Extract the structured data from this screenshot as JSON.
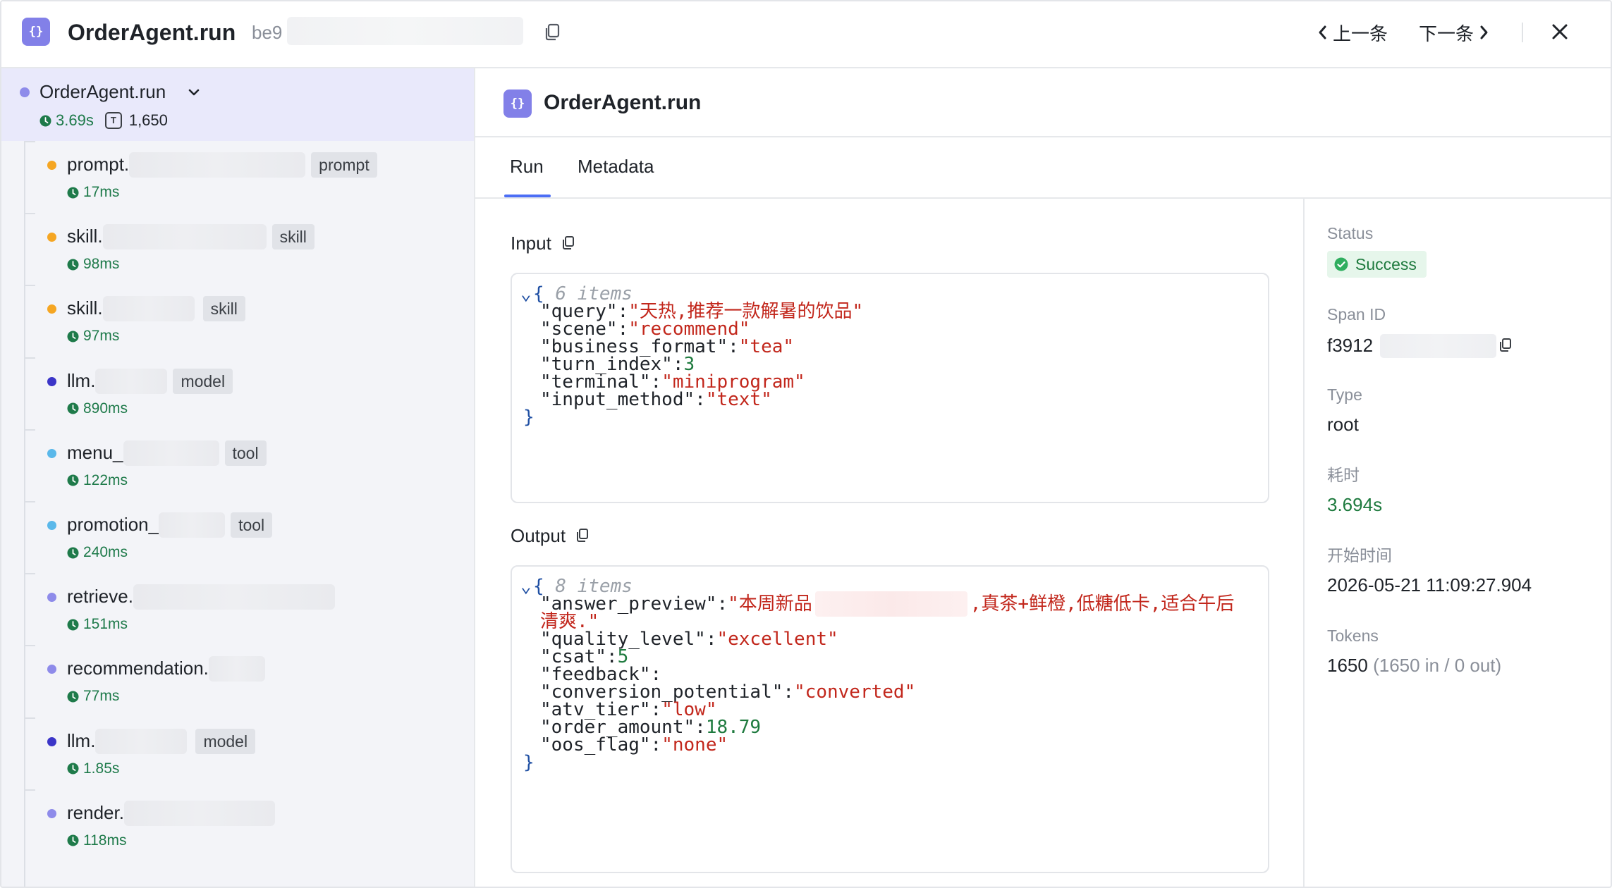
{
  "header": {
    "logo_glyph": "{}",
    "title": "OrderAgent.run",
    "trace_id_prefix": "be9",
    "prev_label": "上一条",
    "next_label": "下一条"
  },
  "tree": {
    "root": {
      "name": "OrderAgent.run",
      "duration": "3.69s",
      "tokens": "1,650",
      "token_glyph": "T"
    },
    "nodes": [
      {
        "name": "prompt.",
        "tag": "prompt",
        "duration": "17ms",
        "color": "#f5a623"
      },
      {
        "name": "skill.",
        "tag": "skill",
        "duration": "98ms",
        "color": "#f5a623"
      },
      {
        "name": "skill.",
        "tag": "skill",
        "duration": "97ms",
        "color": "#f5a623"
      },
      {
        "name": "llm.",
        "tag": "model",
        "duration": "890ms",
        "color": "#3b35c8"
      },
      {
        "name": "menu_",
        "tag": "tool",
        "duration": "122ms",
        "color": "#5ab8ea"
      },
      {
        "name": "promotion_",
        "tag": "tool",
        "duration": "240ms",
        "color": "#5ab8ea"
      },
      {
        "name": "retrieve.",
        "tag": "",
        "duration": "151ms",
        "color": "#8e8bea"
      },
      {
        "name": "recommendation.",
        "tag": "",
        "duration": "77ms",
        "color": "#8e8bea"
      },
      {
        "name": "llm.",
        "tag": "model",
        "duration": "1.85s",
        "color": "#3b35c8"
      },
      {
        "name": "render.",
        "tag": "",
        "duration": "118ms",
        "color": "#8e8bea"
      }
    ]
  },
  "main": {
    "logo_glyph": "{}",
    "title": "OrderAgent.run",
    "tabs": [
      {
        "label": "Run"
      },
      {
        "label": "Metadata"
      }
    ],
    "input": {
      "label": "Input",
      "count": "6 items",
      "entries": [
        {
          "key": "\"query\"",
          "value": "\"天热,推荐一款解暑的饮品\"",
          "kind": "str"
        },
        {
          "key": "\"scene\"",
          "value": "\"recommend\"",
          "kind": "str"
        },
        {
          "key": "\"business_format\"",
          "value": "\"tea\"",
          "kind": "str"
        },
        {
          "key": "\"turn_index\"",
          "value": "3",
          "kind": "num"
        },
        {
          "key": "\"terminal\"",
          "value": "\"miniprogram\"",
          "kind": "str"
        },
        {
          "key": "\"input_method\"",
          "value": "\"text\"",
          "kind": "str"
        }
      ]
    },
    "output": {
      "label": "Output",
      "count": "8 items",
      "answer_key": "\"answer_preview\"",
      "answer_part1": "\"本周新品",
      "answer_part2": ",真茶+鲜橙,低糖低卡,适合午后",
      "answer_part3": "清爽.\"",
      "entries": [
        {
          "key": "\"quality_level\"",
          "value": "\"excellent\"",
          "kind": "str"
        },
        {
          "key": "\"csat\"",
          "value": "5",
          "kind": "num"
        },
        {
          "key": "\"feedback\"",
          "value": "",
          "kind": "str"
        },
        {
          "key": "\"conversion_potential\"",
          "value": "\"converted\"",
          "kind": "str"
        },
        {
          "key": "\"atv_tier\"",
          "value": "\"low\"",
          "kind": "str"
        },
        {
          "key": "\"order_amount\"",
          "value": "18.79",
          "kind": "num"
        },
        {
          "key": "\"oos_flag\"",
          "value": "\"none\"",
          "kind": "str"
        }
      ]
    }
  },
  "details": {
    "status_label": "Status",
    "status_value": "Success",
    "span_id_label": "Span ID",
    "span_id_prefix": "f3912",
    "type_label": "Type",
    "type_value": "root",
    "duration_label": "耗时",
    "duration_value": "3.694s",
    "start_label": "开始时间",
    "start_value": "2026-05-21 11:09:27.904",
    "tokens_label": "Tokens",
    "tokens_value": "1650",
    "tokens_breakdown": "(1650 in / 0 out)"
  },
  "colors": {
    "accent": "#4c6ef5",
    "logo": "#8280e8",
    "success": "#1e7a3e",
    "json_string": "#c2271c",
    "json_number": "#1e7a3e"
  }
}
